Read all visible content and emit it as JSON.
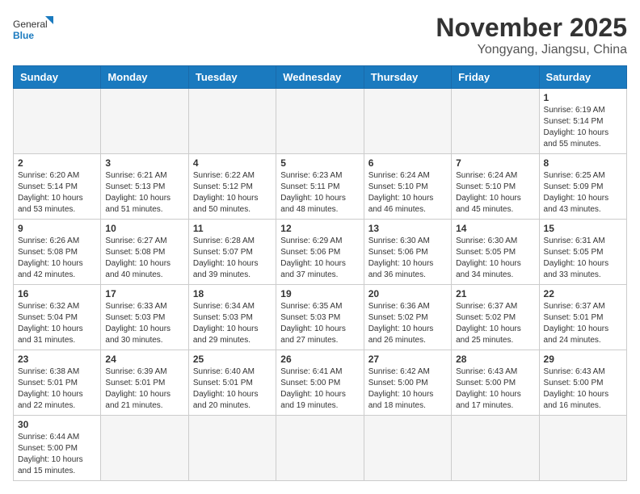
{
  "header": {
    "logo_general": "General",
    "logo_blue": "Blue",
    "month_title": "November 2025",
    "location": "Yongyang, Jiangsu, China"
  },
  "weekdays": [
    "Sunday",
    "Monday",
    "Tuesday",
    "Wednesday",
    "Thursday",
    "Friday",
    "Saturday"
  ],
  "days": [
    {
      "num": "",
      "info": ""
    },
    {
      "num": "",
      "info": ""
    },
    {
      "num": "",
      "info": ""
    },
    {
      "num": "",
      "info": ""
    },
    {
      "num": "",
      "info": ""
    },
    {
      "num": "",
      "info": ""
    },
    {
      "num": "1",
      "info": "Sunrise: 6:19 AM\nSunset: 5:14 PM\nDaylight: 10 hours\nand 55 minutes."
    },
    {
      "num": "2",
      "info": "Sunrise: 6:20 AM\nSunset: 5:14 PM\nDaylight: 10 hours\nand 53 minutes."
    },
    {
      "num": "3",
      "info": "Sunrise: 6:21 AM\nSunset: 5:13 PM\nDaylight: 10 hours\nand 51 minutes."
    },
    {
      "num": "4",
      "info": "Sunrise: 6:22 AM\nSunset: 5:12 PM\nDaylight: 10 hours\nand 50 minutes."
    },
    {
      "num": "5",
      "info": "Sunrise: 6:23 AM\nSunset: 5:11 PM\nDaylight: 10 hours\nand 48 minutes."
    },
    {
      "num": "6",
      "info": "Sunrise: 6:24 AM\nSunset: 5:10 PM\nDaylight: 10 hours\nand 46 minutes."
    },
    {
      "num": "7",
      "info": "Sunrise: 6:24 AM\nSunset: 5:10 PM\nDaylight: 10 hours\nand 45 minutes."
    },
    {
      "num": "8",
      "info": "Sunrise: 6:25 AM\nSunset: 5:09 PM\nDaylight: 10 hours\nand 43 minutes."
    },
    {
      "num": "9",
      "info": "Sunrise: 6:26 AM\nSunset: 5:08 PM\nDaylight: 10 hours\nand 42 minutes."
    },
    {
      "num": "10",
      "info": "Sunrise: 6:27 AM\nSunset: 5:08 PM\nDaylight: 10 hours\nand 40 minutes."
    },
    {
      "num": "11",
      "info": "Sunrise: 6:28 AM\nSunset: 5:07 PM\nDaylight: 10 hours\nand 39 minutes."
    },
    {
      "num": "12",
      "info": "Sunrise: 6:29 AM\nSunset: 5:06 PM\nDaylight: 10 hours\nand 37 minutes."
    },
    {
      "num": "13",
      "info": "Sunrise: 6:30 AM\nSunset: 5:06 PM\nDaylight: 10 hours\nand 36 minutes."
    },
    {
      "num": "14",
      "info": "Sunrise: 6:30 AM\nSunset: 5:05 PM\nDaylight: 10 hours\nand 34 minutes."
    },
    {
      "num": "15",
      "info": "Sunrise: 6:31 AM\nSunset: 5:05 PM\nDaylight: 10 hours\nand 33 minutes."
    },
    {
      "num": "16",
      "info": "Sunrise: 6:32 AM\nSunset: 5:04 PM\nDaylight: 10 hours\nand 31 minutes."
    },
    {
      "num": "17",
      "info": "Sunrise: 6:33 AM\nSunset: 5:03 PM\nDaylight: 10 hours\nand 30 minutes."
    },
    {
      "num": "18",
      "info": "Sunrise: 6:34 AM\nSunset: 5:03 PM\nDaylight: 10 hours\nand 29 minutes."
    },
    {
      "num": "19",
      "info": "Sunrise: 6:35 AM\nSunset: 5:03 PM\nDaylight: 10 hours\nand 27 minutes."
    },
    {
      "num": "20",
      "info": "Sunrise: 6:36 AM\nSunset: 5:02 PM\nDaylight: 10 hours\nand 26 minutes."
    },
    {
      "num": "21",
      "info": "Sunrise: 6:37 AM\nSunset: 5:02 PM\nDaylight: 10 hours\nand 25 minutes."
    },
    {
      "num": "22",
      "info": "Sunrise: 6:37 AM\nSunset: 5:01 PM\nDaylight: 10 hours\nand 24 minutes."
    },
    {
      "num": "23",
      "info": "Sunrise: 6:38 AM\nSunset: 5:01 PM\nDaylight: 10 hours\nand 22 minutes."
    },
    {
      "num": "24",
      "info": "Sunrise: 6:39 AM\nSunset: 5:01 PM\nDaylight: 10 hours\nand 21 minutes."
    },
    {
      "num": "25",
      "info": "Sunrise: 6:40 AM\nSunset: 5:01 PM\nDaylight: 10 hours\nand 20 minutes."
    },
    {
      "num": "26",
      "info": "Sunrise: 6:41 AM\nSunset: 5:00 PM\nDaylight: 10 hours\nand 19 minutes."
    },
    {
      "num": "27",
      "info": "Sunrise: 6:42 AM\nSunset: 5:00 PM\nDaylight: 10 hours\nand 18 minutes."
    },
    {
      "num": "28",
      "info": "Sunrise: 6:43 AM\nSunset: 5:00 PM\nDaylight: 10 hours\nand 17 minutes."
    },
    {
      "num": "29",
      "info": "Sunrise: 6:43 AM\nSunset: 5:00 PM\nDaylight: 10 hours\nand 16 minutes."
    },
    {
      "num": "30",
      "info": "Sunrise: 6:44 AM\nSunset: 5:00 PM\nDaylight: 10 hours\nand 15 minutes."
    },
    {
      "num": "",
      "info": ""
    },
    {
      "num": "",
      "info": ""
    },
    {
      "num": "",
      "info": ""
    },
    {
      "num": "",
      "info": ""
    },
    {
      "num": "",
      "info": ""
    },
    {
      "num": "",
      "info": ""
    }
  ]
}
